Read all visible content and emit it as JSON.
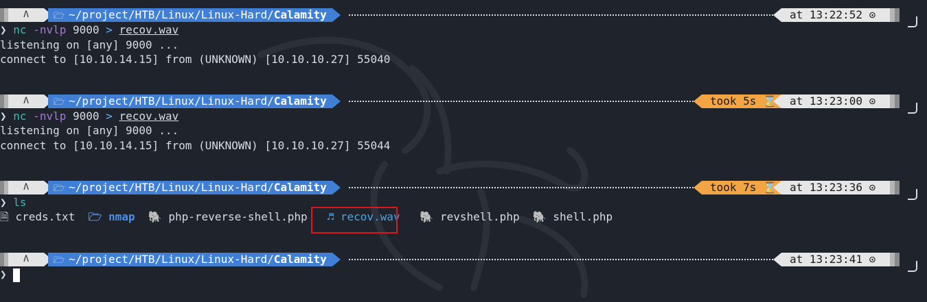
{
  "os_icon": "linux-tux-icon",
  "folder_icon": "folder-icon",
  "path_prefix": "~/project/HTB/Linux/Linux-Hard/",
  "path_current": "Calamity",
  "prompt_arrow": "❯",
  "hourglass_icon": "⌛",
  "clock_icon": "⊙",
  "colors": {
    "path_bg": "#3f7fd6",
    "took_bg": "#f3a443",
    "time_bg": "#e6e6e6",
    "highlight": "#e0141e",
    "cmd": "#40b8b0",
    "flag": "#a679d6"
  },
  "blocks": [
    {
      "time": "at 13:22:52",
      "took": "",
      "command": {
        "cmd": "nc",
        "flags": "-nvlp",
        "arg": "9000",
        "redir": ">",
        "file": "recov.wav"
      },
      "output": [
        "listening on [any] 9000 ...",
        "connect to [10.10.14.15] from (UNKNOWN) [10.10.10.27] 55040"
      ]
    },
    {
      "time": "at 13:23:00",
      "took": "took 5s",
      "command": {
        "cmd": "nc",
        "flags": "-nvlp",
        "arg": "9000",
        "redir": ">",
        "file": "recov.wav"
      },
      "output": [
        "listening on [any] 9000 ...",
        "connect to [10.10.14.15] from (UNKNOWN) [10.10.10.27] 55044"
      ]
    },
    {
      "time": "at 13:23:36",
      "took": "took 7s",
      "command": {
        "cmd": "ls"
      },
      "ls": [
        {
          "icon": "🗎",
          "name": "creds.txt",
          "kind": "file"
        },
        {
          "icon": "🗁",
          "name": "nmap",
          "kind": "dir"
        },
        {
          "icon": "🐘",
          "name": "php-reverse-shell.php",
          "kind": "php"
        },
        {
          "icon": "♬",
          "name": "recov.wav",
          "kind": "audio"
        },
        {
          "icon": "🐘",
          "name": "revshell.php",
          "kind": "php"
        },
        {
          "icon": "🐘",
          "name": "shell.php",
          "kind": "php"
        }
      ]
    },
    {
      "time": "at 13:23:41",
      "took": ""
    }
  ]
}
